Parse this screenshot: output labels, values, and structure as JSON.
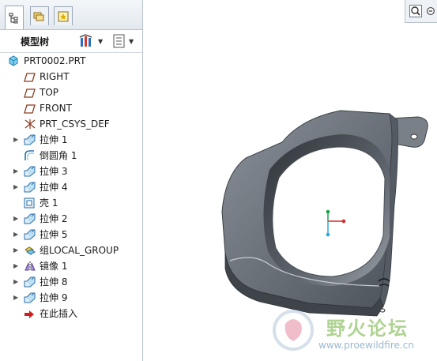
{
  "panel": {
    "tabs": [
      {
        "icon": "model-tree-icon",
        "active": true
      },
      {
        "icon": "folder-browser-icon",
        "active": false
      },
      {
        "icon": "favorites-icon",
        "active": false
      }
    ],
    "title": "模型树",
    "settings_icon": "tree-settings-icon",
    "columns_icon": "show-columns-icon"
  },
  "tree": {
    "items": [
      {
        "label": "PRT0002.PRT",
        "icon": "part-icon",
        "expand": false
      },
      {
        "label": "RIGHT",
        "icon": "datum-plane-icon",
        "expand": false
      },
      {
        "label": "TOP",
        "icon": "datum-plane-icon",
        "expand": false
      },
      {
        "label": "FRONT",
        "icon": "datum-plane-icon",
        "expand": false
      },
      {
        "label": "PRT_CSYS_DEF",
        "icon": "coordinate-system-icon",
        "expand": false
      },
      {
        "label": "拉伸 1",
        "icon": "extrude-icon",
        "expand": true
      },
      {
        "label": "倒圆角 1",
        "icon": "round-icon",
        "expand": false
      },
      {
        "label": "拉伸 3",
        "icon": "extrude-icon",
        "expand": true
      },
      {
        "label": "拉伸 4",
        "icon": "extrude-icon",
        "expand": true
      },
      {
        "label": "壳 1",
        "icon": "shell-icon",
        "expand": false
      },
      {
        "label": "拉伸 2",
        "icon": "extrude-icon",
        "expand": true
      },
      {
        "label": "拉伸 5",
        "icon": "extrude-icon",
        "expand": true
      },
      {
        "label": "组LOCAL_GROUP",
        "icon": "group-icon",
        "expand": true
      },
      {
        "label": "镜像 1",
        "icon": "mirror-icon",
        "expand": true
      },
      {
        "label": "拉伸 8",
        "icon": "extrude-icon",
        "expand": true
      },
      {
        "label": "拉伸 9",
        "icon": "extrude-icon",
        "expand": true
      },
      {
        "label": "在此插入",
        "icon": "insert-here-arrow-icon",
        "expand": false
      }
    ]
  },
  "graphics": {
    "view_buttons": [
      "zoom-in-icon",
      "zoom-out-icon"
    ],
    "model": "3d-part-model",
    "triad": "coordinate-triad-icon",
    "watermark": {
      "text": "野火论坛",
      "url": "www.proewildfire.cn"
    }
  },
  "colors": {
    "accent": "#1e7fc8",
    "model": "#6e747c",
    "panel_border": "#b9c3cf"
  }
}
